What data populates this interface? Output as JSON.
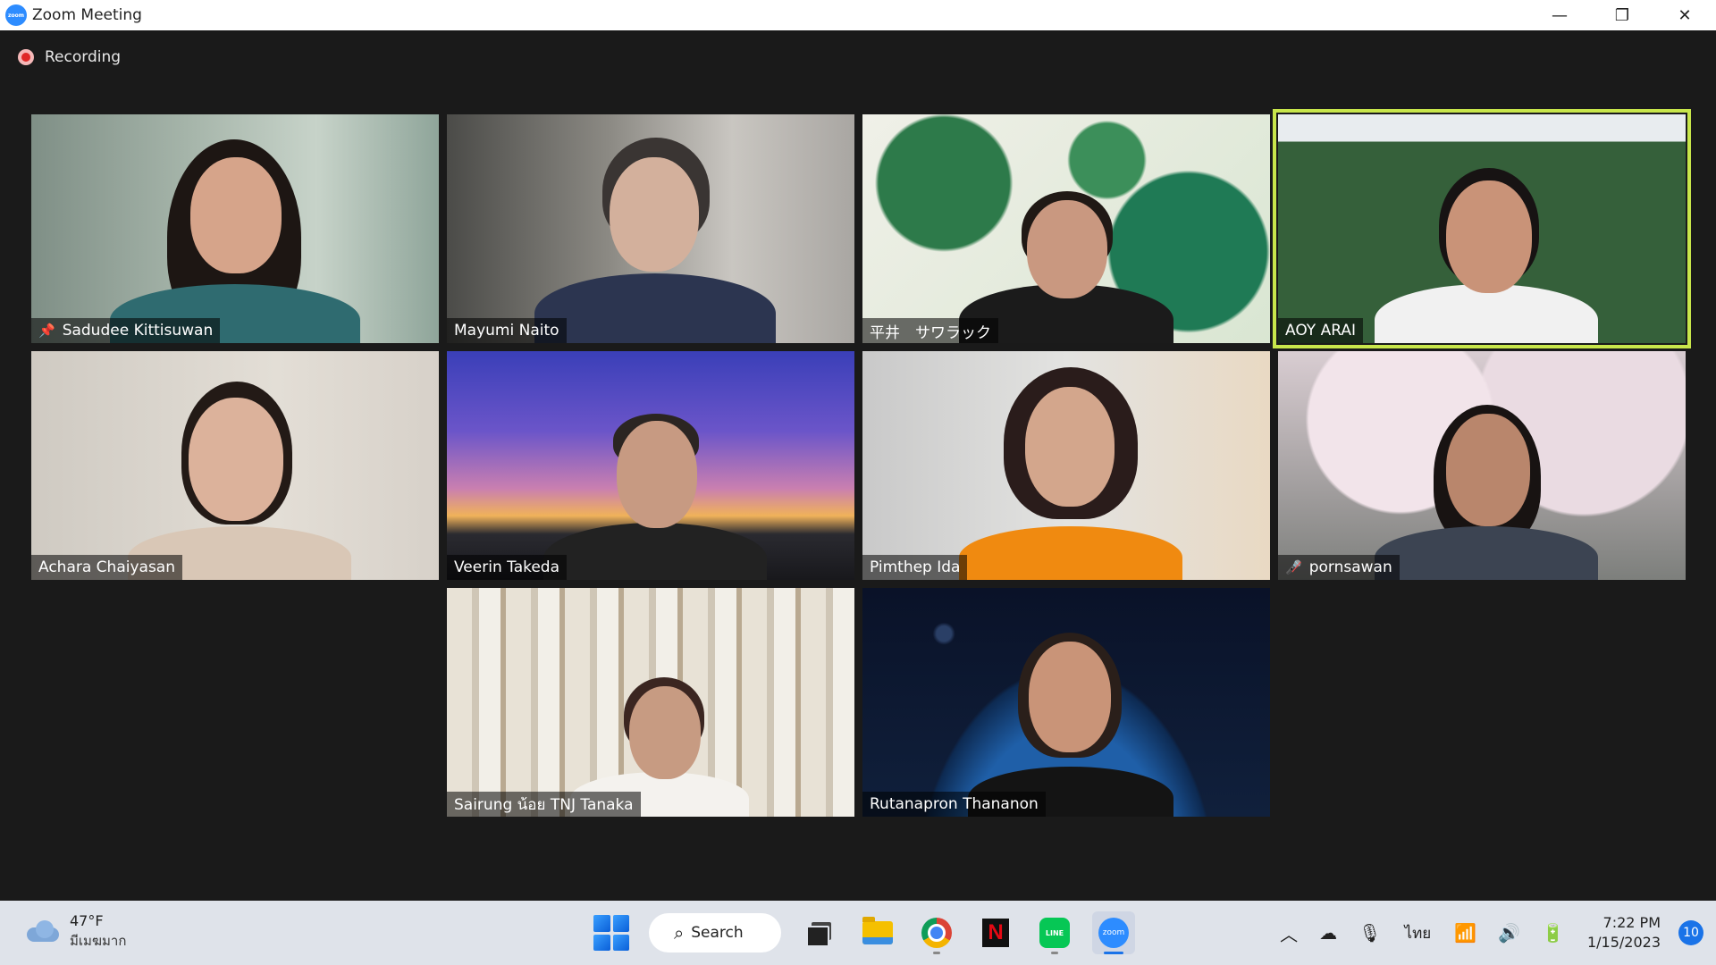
{
  "window": {
    "title": "Zoom Meeting"
  },
  "recording": {
    "label": "Recording"
  },
  "participants": [
    {
      "name": "Sadudee Kittisuwan",
      "pinned": true,
      "muted": false,
      "active": false
    },
    {
      "name": "Mayumi Naito",
      "pinned": false,
      "muted": false,
      "active": false
    },
    {
      "name": "平井　サワラック",
      "pinned": false,
      "muted": false,
      "active": false
    },
    {
      "name": "AOY ARAI",
      "pinned": false,
      "muted": false,
      "active": true
    },
    {
      "name": "Achara Chaiyasan",
      "pinned": false,
      "muted": false,
      "active": false
    },
    {
      "name": "Veerin Takeda",
      "pinned": false,
      "muted": false,
      "active": false
    },
    {
      "name": "Pimthep Ida",
      "pinned": false,
      "muted": false,
      "active": false
    },
    {
      "name": "pornsawan",
      "pinned": false,
      "muted": true,
      "active": false
    },
    {
      "name": "Sairung  น้อย TNJ Tanaka",
      "pinned": false,
      "muted": false,
      "active": false
    },
    {
      "name": "Rutanapron Thananon",
      "pinned": false,
      "muted": false,
      "active": false
    }
  ],
  "colors": {
    "active_speaker": "#c8e64b",
    "recording": "#e02828",
    "zoom_blue": "#2d8cff"
  },
  "taskbar": {
    "weather": {
      "temp": "47°F",
      "condition": "มีเมฆมาก"
    },
    "search_label": "Search",
    "language": "ไทย",
    "time": "7:22 PM",
    "date": "1/15/2023",
    "notification_count": "10"
  }
}
